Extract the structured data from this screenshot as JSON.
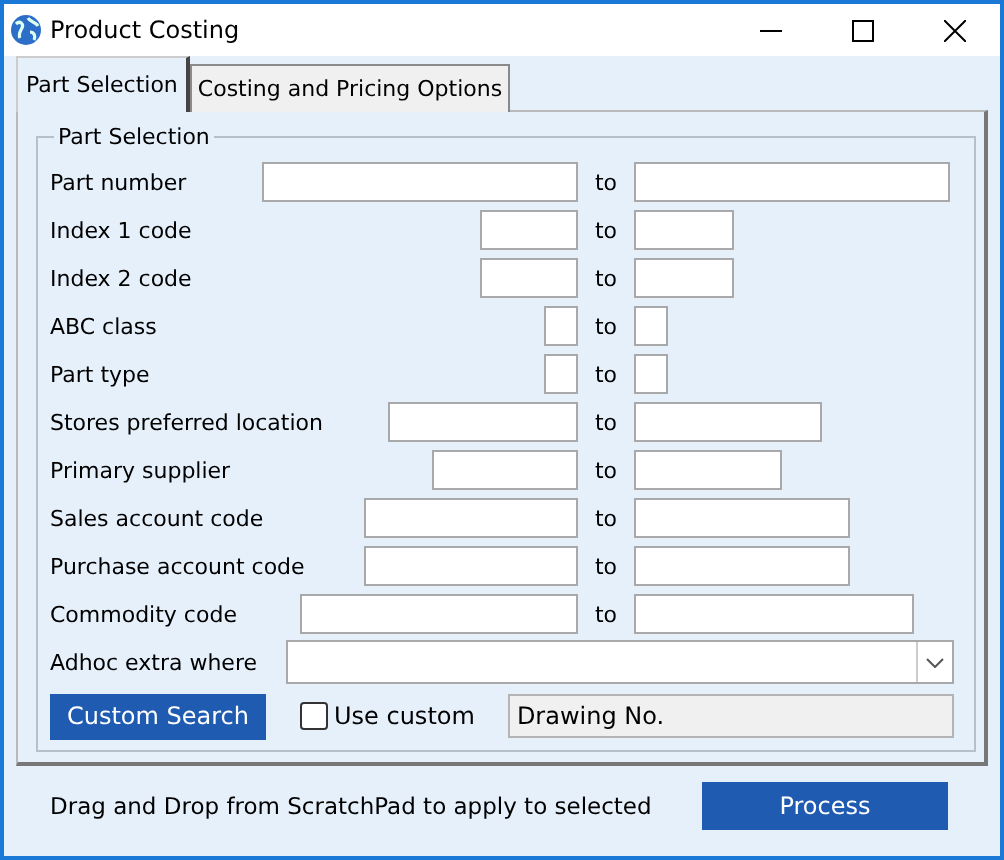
{
  "window": {
    "title": "Product Costing"
  },
  "tabs": [
    {
      "label": "Part Selection",
      "selected": true
    },
    {
      "label": "Costing and Pricing Options",
      "selected": false
    }
  ],
  "group": {
    "title": "Part Selection"
  },
  "ranges": [
    {
      "label": "Part number",
      "separator": "to"
    },
    {
      "label": "Index 1 code",
      "separator": "to"
    },
    {
      "label": "Index 2 code",
      "separator": "to"
    },
    {
      "label": "ABC class",
      "separator": "to"
    },
    {
      "label": "Part type",
      "separator": "to"
    },
    {
      "label": "Stores preferred location",
      "separator": "to"
    },
    {
      "label": "Primary supplier",
      "separator": "to"
    },
    {
      "label": "Sales account code",
      "separator": "to"
    },
    {
      "label": "Purchase account code",
      "separator": "to"
    },
    {
      "label": "Commodity code",
      "separator": "to"
    }
  ],
  "adhoc": {
    "label": "Adhoc extra where"
  },
  "custom_search_button": "Custom Search",
  "use_custom": {
    "label": "Use custom",
    "checked": false
  },
  "custom_field": {
    "value": "Drawing No.",
    "disabled": true
  },
  "footer": {
    "hint": "Drag and Drop from ScratchPad to apply to selected",
    "process_button": "Process"
  }
}
